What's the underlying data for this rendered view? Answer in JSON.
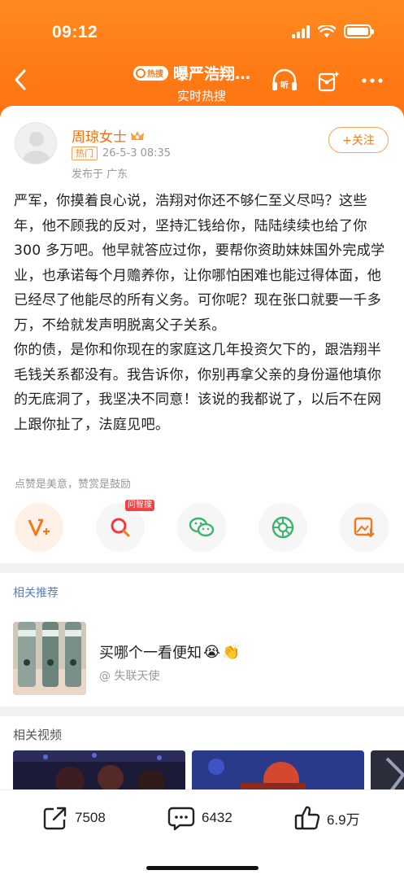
{
  "status_bar": {
    "time": "09:12"
  },
  "nav": {
    "hot_badge": "热搜",
    "title": "曝严浩翔…",
    "subtitle": "实时热搜"
  },
  "post": {
    "author_name": "周琼女士",
    "hot_tag": "热门",
    "timestamp": "26-5-3 08:35",
    "location": "发布于 广东",
    "follow_label": "+关注",
    "paragraphs": [
      "严军，你摸着良心说，浩翔对你还不够仁至义尽吗？这些年，他不顾我的反对，坚持汇钱给你，陆陆续续也给了你 300 多万吧。他早就答应过你，要帮你资助妹妹国外完成学业，也承诺每个月赡养你，让你哪怕困难也能过得体面，他已经尽了他能尽的所有义务。可你呢？现在张口就要一千多万，不给就发声明脱离父子关系。",
      "你的债，是你和你现在的家庭这几年投资欠下的，跟浩翔半毛钱关系都没有。我告诉你，你别再拿父亲的身份逼他填你的无底洞了，我坚决不同意！该说的我都说了，以后不在网上跟你扯了，法庭见吧。"
    ],
    "like_hint": "点赞是美意，赞赏是鼓励",
    "ai_badge": "问智搜"
  },
  "recommend": {
    "section_title": "相关推荐",
    "item_text": "买哪个一看便知",
    "item_author": "@ 失联天使"
  },
  "videos": {
    "section_title": "相关视频"
  },
  "bottom_bar": {
    "repost_count": "7508",
    "comment_count": "6432",
    "like_count": "6.9万"
  },
  "colors": {
    "brand_orange": "#ff7a14",
    "author_orange": "#f56c0e",
    "link_blue": "#5a7fb5"
  }
}
